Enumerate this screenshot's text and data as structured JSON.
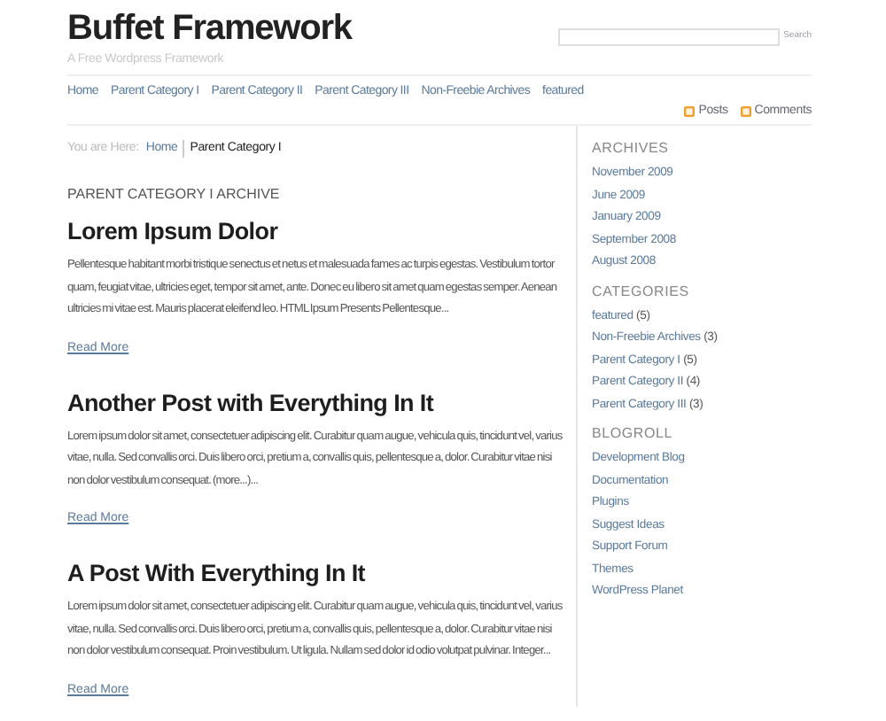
{
  "header": {
    "title": "Buffet Framework",
    "tagline": "A Free Wordpress Framework",
    "search": {
      "button": "Search"
    }
  },
  "nav": [
    "Home",
    "Parent Category I",
    "Parent Category II",
    "Parent Category III",
    "Non-Freebie Archives",
    "featured"
  ],
  "feeds": [
    "Posts",
    "Comments"
  ],
  "breadcrumb": {
    "label": "You are Here:",
    "links": [
      "Home"
    ],
    "current": "Parent Category I"
  },
  "archive_heading": "PARENT CATEGORY I ARCHIVE",
  "posts": [
    {
      "title": "Lorem Ipsum Dolor",
      "excerpt": "Pellentesque habitant morbi tristique senectus et netus et malesuada fames ac turpis egestas. Vestibulum tortor quam, feugiat vitae, ultricies eget, tempor sit amet, ante. Donec eu libero sit amet quam egestas semper. Aenean ultricies mi vitae est. Mauris placerat eleifend leo. HTML Ipsum Presents Pellentesque...",
      "more": "Read More"
    },
    {
      "title": "Another Post with Everything In It",
      "excerpt": "Lorem ipsum dolor sit amet, consectetuer adipiscing elit. Curabitur quam augue, vehicula quis, tincidunt vel, varius vitae, nulla. Sed convallis orci. Duis libero orci, pretium a, convallis quis, pellentesque a, dolor. Curabitur vitae nisi non dolor vestibulum consequat. (more...)...",
      "more": "Read More"
    },
    {
      "title": "A Post With Everything In It",
      "excerpt": "Lorem ipsum dolor sit amet, consectetuer adipiscing elit. Curabitur quam augue, vehicula quis, tincidunt vel, varius vitae, nulla. Sed convallis orci. Duis libero orci, pretium a, convallis quis, pellentesque a, dolor. Curabitur vitae nisi non dolor vestibulum consequat. Proin vestibulum. Ut ligula. Nullam sed dolor id odio volutpat pulvinar. Integer...",
      "more": "Read More"
    }
  ],
  "sidebar": [
    {
      "heading": "ARCHIVES",
      "items": [
        {
          "label": "November 2009"
        },
        {
          "label": "June 2009"
        },
        {
          "label": "January 2009"
        },
        {
          "label": "September 2008"
        },
        {
          "label": "August 2008"
        }
      ]
    },
    {
      "heading": "CATEGORIES",
      "items": [
        {
          "label": "featured",
          "count": "(5)"
        },
        {
          "label": "Non-Freebie Archives",
          "count": "(3)"
        },
        {
          "label": "Parent Category I",
          "count": "(5)"
        },
        {
          "label": "Parent Category II",
          "count": "(4)"
        },
        {
          "label": "Parent Category III",
          "count": "(3)"
        }
      ]
    },
    {
      "heading": "BLOGROLL",
      "items": [
        {
          "label": "Development Blog"
        },
        {
          "label": "Documentation"
        },
        {
          "label": "Plugins"
        },
        {
          "label": "Suggest Ideas"
        },
        {
          "label": "Support Forum"
        },
        {
          "label": "Themes"
        },
        {
          "label": "WordPress Planet"
        }
      ]
    }
  ]
}
